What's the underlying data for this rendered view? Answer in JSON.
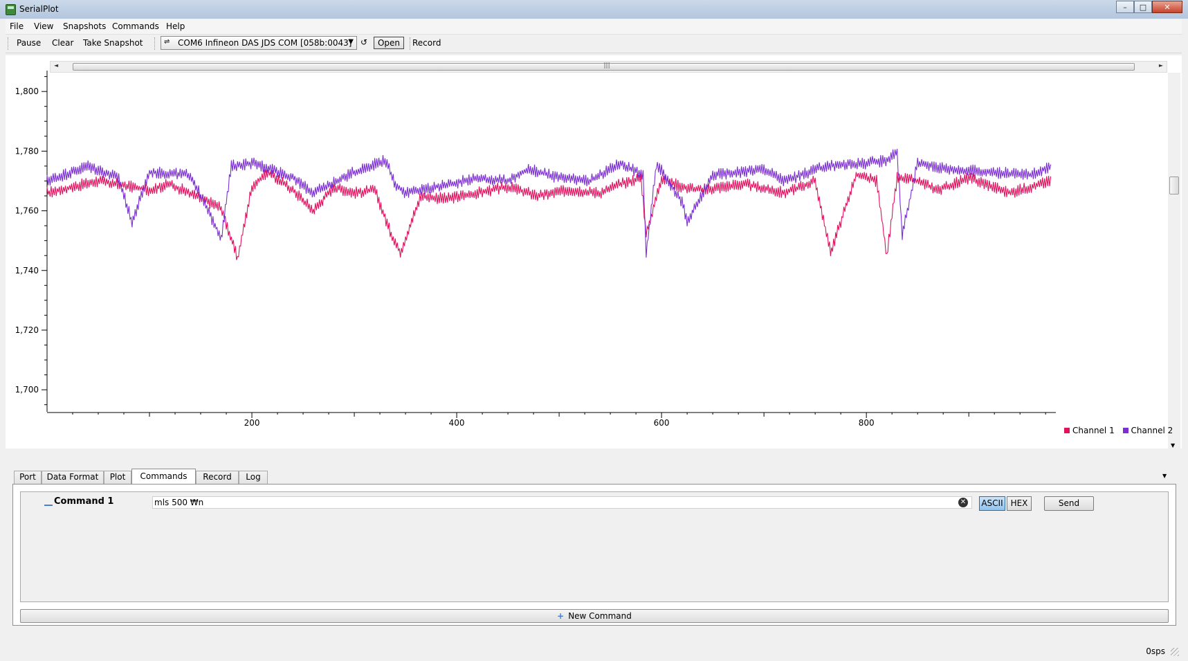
{
  "window": {
    "title": "SerialPlot",
    "minimize": "–",
    "maximize": "□",
    "close": "✕"
  },
  "menu": {
    "items": [
      "File",
      "View",
      "Snapshots",
      "Commands",
      "Help"
    ]
  },
  "toolbar": {
    "pause": "Pause",
    "clear": "Clear",
    "snapshot": "Take Snapshot",
    "port": "COM6 Infineon DAS JDS COM [058b:0043]",
    "refresh_icon": "↺",
    "open": "Open",
    "record": "Record"
  },
  "chart_data": {
    "type": "line",
    "x_range": [
      0,
      985
    ],
    "y_range": [
      1694,
      1807
    ],
    "x_ticks": [
      200,
      400,
      600,
      800
    ],
    "x_tick_labels": [
      "200",
      "400",
      "600",
      "800"
    ],
    "y_ticks": [
      1700,
      1720,
      1740,
      1760,
      1780,
      1800
    ],
    "y_tick_labels": [
      "1,700",
      "1,720",
      "1,740",
      "1,760",
      "1,780",
      "1,800"
    ],
    "legend_position": "bottom-right",
    "series": [
      {
        "name": "Channel 1",
        "color": "#e0115f",
        "x": [
          0,
          50,
          100,
          120,
          145,
          170,
          186,
          200,
          215,
          240,
          260,
          280,
          300,
          320,
          335,
          345,
          365,
          390,
          420,
          450,
          480,
          510,
          540,
          560,
          580,
          585,
          600,
          620,
          640,
          680,
          720,
          750,
          765,
          790,
          810,
          820,
          830,
          850,
          870,
          900,
          940,
          980
        ],
        "y": [
          1766,
          1770,
          1767,
          1769,
          1765,
          1761,
          1744,
          1768,
          1773,
          1767,
          1760,
          1768,
          1766,
          1767,
          1753,
          1746,
          1765,
          1764,
          1766,
          1768,
          1765,
          1767,
          1766,
          1769,
          1771,
          1752,
          1771,
          1768,
          1767,
          1769,
          1766,
          1770,
          1746,
          1772,
          1770,
          1745,
          1771,
          1770,
          1767,
          1771,
          1766,
          1770
        ]
      },
      {
        "name": "Channel 2",
        "color": "#7b2fd1",
        "x": [
          0,
          40,
          70,
          83,
          100,
          140,
          170,
          180,
          200,
          220,
          240,
          260,
          300,
          330,
          340,
          350,
          380,
          420,
          450,
          470,
          500,
          530,
          560,
          582,
          585,
          595,
          620,
          625,
          650,
          700,
          720,
          760,
          800,
          820,
          830,
          835,
          850,
          880,
          920,
          960,
          980
        ],
        "y": [
          1770,
          1775,
          1771,
          1756,
          1773,
          1772,
          1751,
          1775,
          1776,
          1774,
          1771,
          1766,
          1773,
          1777,
          1769,
          1766,
          1768,
          1771,
          1770,
          1774,
          1771,
          1770,
          1776,
          1772,
          1745,
          1776,
          1763,
          1756,
          1772,
          1774,
          1770,
          1775,
          1776,
          1777,
          1780,
          1752,
          1776,
          1774,
          1773,
          1772,
          1775
        ]
      }
    ]
  },
  "tabs": [
    "Port",
    "Data Format",
    "Plot",
    "Commands",
    "Record",
    "Log"
  ],
  "command": {
    "name": "Command 1",
    "value": "mls 500 ₩n",
    "ascii": "ASCII",
    "hex": "HEX",
    "send": "Send",
    "clear_icon": "✕"
  },
  "new_command": "New Command",
  "status": {
    "rate": "0sps"
  }
}
